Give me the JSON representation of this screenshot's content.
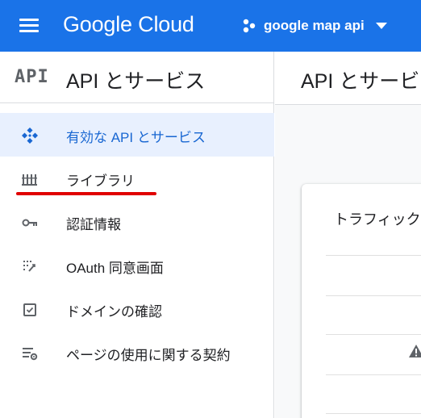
{
  "topbar": {
    "brand": "Google Cloud",
    "project_name": "google map api",
    "colors": {
      "background": "#1a73e8",
      "text": "#ffffff"
    }
  },
  "sidebar": {
    "badge": "API",
    "title": "API とサービス",
    "items": [
      {
        "label": "有効な API とサービス",
        "icon": "api-hub-icon",
        "active": true
      },
      {
        "label": "ライブラリ",
        "icon": "library-icon",
        "active": false
      },
      {
        "label": "認証情報",
        "icon": "key-icon",
        "active": false
      },
      {
        "label": "OAuth 同意画面",
        "icon": "oauth-consent-icon",
        "active": false
      },
      {
        "label": "ドメインの確認",
        "icon": "checkbox-icon",
        "active": false
      },
      {
        "label": "ページの使用に関する契約",
        "icon": "settings-list-icon",
        "active": false
      }
    ],
    "colors": {
      "active_bg": "#e8f0fe",
      "active_text": "#1967d2",
      "highlight": "#e00000"
    }
  },
  "main": {
    "title": "API とサービス",
    "card_title": "トラフィック",
    "warning_icon": "warning-icon"
  }
}
